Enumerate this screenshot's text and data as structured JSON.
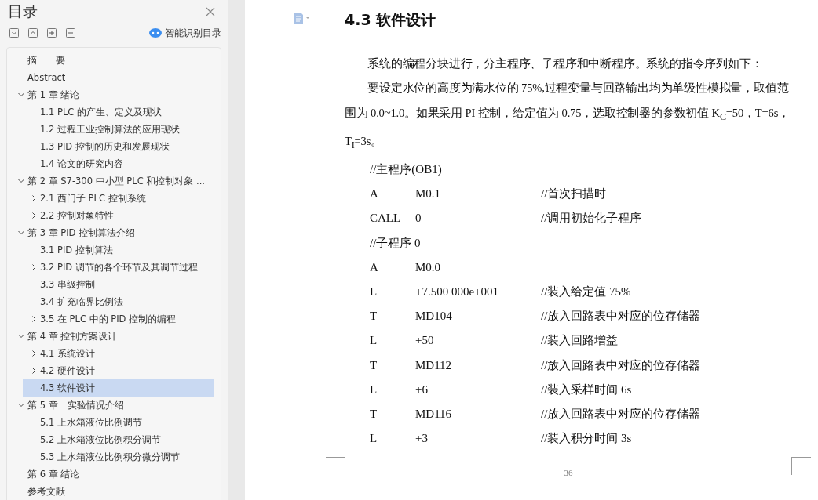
{
  "sidebar": {
    "title": "目录",
    "smart_button": "智能识别目录",
    "toc": [
      {
        "label": "摘　　要",
        "kind": "leaf",
        "selected": false
      },
      {
        "label": "Abstract",
        "kind": "leaf",
        "selected": false
      },
      {
        "label": "第 1 章  绪论",
        "kind": "branch",
        "expanded": true,
        "selected": false,
        "children": [
          {
            "label": "1.1 PLC 的产生、定义及现状",
            "kind": "leaf",
            "selected": false
          },
          {
            "label": "1.2  过程工业控制算法的应用现状",
            "kind": "leaf",
            "selected": false
          },
          {
            "label": "1.3 PID 控制的历史和发展现状",
            "kind": "leaf",
            "selected": false
          },
          {
            "label": "1.4  论文的研究内容",
            "kind": "leaf",
            "selected": false
          }
        ]
      },
      {
        "label": "第 2 章  S7-300 中小型 PLC 和控制对象 ...",
        "kind": "branch",
        "expanded": true,
        "selected": false,
        "children": [
          {
            "label": "2.1  西门子 PLC 控制系统",
            "kind": "branch",
            "expanded": false,
            "selected": false
          },
          {
            "label": "2.2  控制对象特性",
            "kind": "branch",
            "expanded": false,
            "selected": false
          }
        ]
      },
      {
        "label": "第 3 章  PID 控制算法介绍",
        "kind": "branch",
        "expanded": true,
        "selected": false,
        "children": [
          {
            "label": "3.1 PID 控制算法",
            "kind": "leaf",
            "selected": false
          },
          {
            "label": "3.2 PID 调节的各个环节及其调节过程",
            "kind": "branch",
            "expanded": false,
            "selected": false
          },
          {
            "label": "3.3  串级控制",
            "kind": "leaf",
            "selected": false
          },
          {
            "label": "3.4  扩充临界比例法",
            "kind": "leaf",
            "selected": false
          },
          {
            "label": "3.5 在 PLC 中的 PID 控制的编程",
            "kind": "branch",
            "expanded": false,
            "selected": false
          }
        ]
      },
      {
        "label": "第 4 章  控制方案设计",
        "kind": "branch",
        "expanded": true,
        "selected": false,
        "children": [
          {
            "label": "4.1  系统设计",
            "kind": "branch",
            "expanded": false,
            "selected": false
          },
          {
            "label": "4.2  硬件设计",
            "kind": "branch",
            "expanded": false,
            "selected": false
          },
          {
            "label": "4.3  软件设计",
            "kind": "leaf",
            "selected": true
          }
        ]
      },
      {
        "label": "第 5 章　实验情况介绍",
        "kind": "branch",
        "expanded": true,
        "selected": false,
        "children": [
          {
            "label": "5.1  上水箱液位比例调节",
            "kind": "leaf",
            "selected": false
          },
          {
            "label": "5.2  上水箱液位比例积分调节",
            "kind": "leaf",
            "selected": false
          },
          {
            "label": "5.3  上水箱液位比例积分微分调节",
            "kind": "leaf",
            "selected": false
          }
        ]
      },
      {
        "label": "第 6 章  结论",
        "kind": "leaf",
        "selected": false
      },
      {
        "label": "参考文献",
        "kind": "leaf",
        "selected": false
      }
    ]
  },
  "document": {
    "heading": "4.3  软件设计",
    "paragraphs": [
      "系统的编程分块进行，分主程序、子程序和中断程序。系统的指令序列如下：",
      "要设定水位的高度为满水位的 75%,过程变量与回路输出均为单级性模拟量，取值范围为 0.0~1.0。如果采用 PI 控制，给定值为 0.75，选取控制器的参数初值 K$_{C}$=50，T=6s，T$_{I}$=3s。"
    ],
    "code": [
      {
        "kind": "comment",
        "text": "//主程序(OB1)"
      },
      {
        "kind": "instruction",
        "op": "A",
        "operand": "M0.1",
        "comment": "//首次扫描时"
      },
      {
        "kind": "instruction",
        "op": "CALL",
        "operand": "0",
        "comment": "//调用初始化子程序"
      },
      {
        "kind": "comment",
        "text": "//子程序 0"
      },
      {
        "kind": "instruction",
        "op": "A",
        "operand": "M0.0"
      },
      {
        "kind": "instruction",
        "op": "L",
        "operand": "+7.500 000e+001",
        "comment": "//装入给定值 75%"
      },
      {
        "kind": "instruction",
        "op": "T",
        "operand": "MD104",
        "comment": "//放入回路表中对应的位存储器"
      },
      {
        "kind": "instruction",
        "op": "L",
        "operand": "+50",
        "comment": "//装入回路增益"
      },
      {
        "kind": "instruction",
        "op": "T",
        "operand": "MD112",
        "comment": "//放入回路表中对应的位存储器"
      },
      {
        "kind": "instruction",
        "op": "L",
        "operand": "+6",
        "comment": "//装入采样时间 6s"
      },
      {
        "kind": "instruction",
        "op": "T",
        "operand": "MD116",
        "comment": "//放入回路表中对应的位存储器"
      },
      {
        "kind": "instruction",
        "op": "L",
        "operand": "+3",
        "comment": "//装入积分时间 3s"
      }
    ],
    "page_number": "36"
  }
}
